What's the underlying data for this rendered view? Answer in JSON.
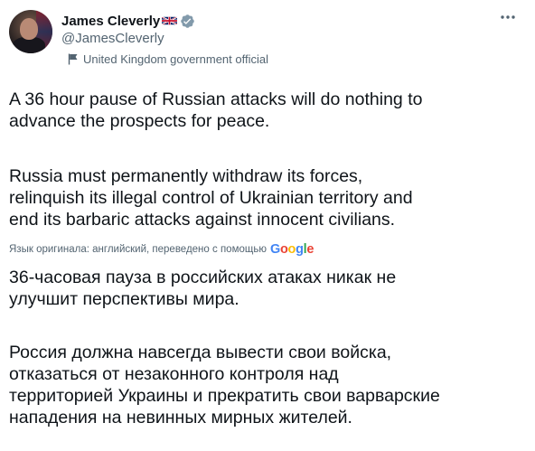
{
  "author": {
    "name": "James Cleverly",
    "handle": "@JamesCleverly",
    "label": "United Kingdom government official"
  },
  "tweet": {
    "original": [
      [
        "A 36 hour pause of Russian attacks will do nothing to",
        "advance the prospects for peace."
      ],
      [
        "Russia must permanently withdraw its forces,",
        "relinquish its illegal control of Ukrainian territory and",
        "end its barbaric attacks against innocent civilians."
      ]
    ],
    "translation_note": "Язык оригинала: английский, переведено с помощью",
    "translation_provider": [
      "G",
      "o",
      "o",
      "g",
      "l",
      "e"
    ],
    "translated": [
      [
        "36-часовая пауза в российских атаках никак не",
        "улучшит перспективы мира."
      ],
      [
        "Россия должна навсегда вывести свои войска,",
        "отказаться от незаконного контроля над",
        "территорией Украины и прекратить свои варварские",
        "нападения на невинных мирных жителей."
      ]
    ]
  },
  "colors": {
    "text": "#0f1419",
    "secondary": "#536471",
    "verified": "#829aab",
    "google_blue": "#4285F4",
    "google_red": "#EA4335",
    "google_yellow": "#FBBC05",
    "google_green": "#34A853"
  },
  "icons": [
    "uk-flag-icon",
    "verified-badge-icon",
    "government-flag-icon",
    "more-options-icon"
  ]
}
